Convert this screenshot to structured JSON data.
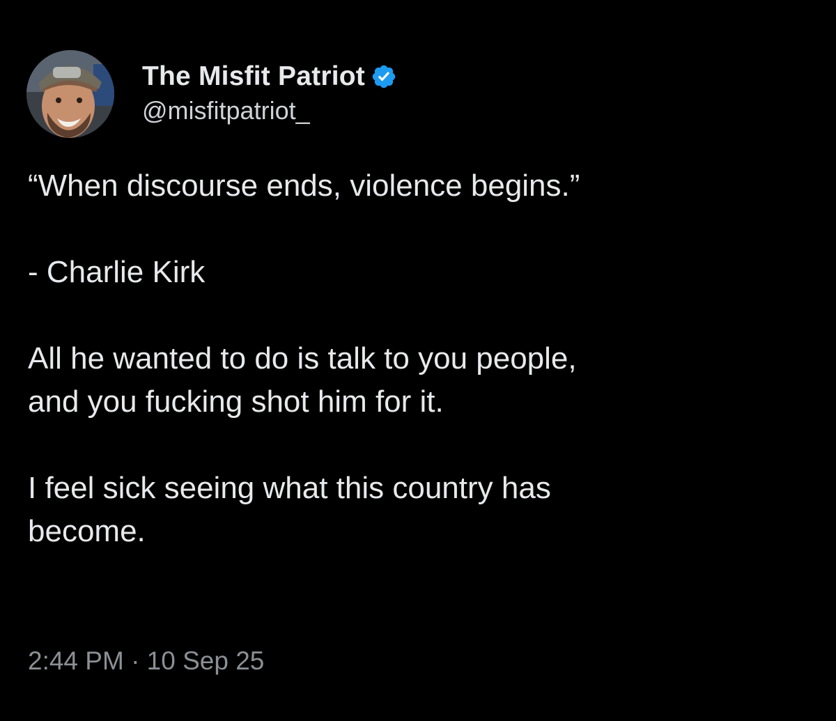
{
  "author": {
    "display_name": "The Misfit Patriot",
    "handle": "@misfitpatriot_",
    "verified": true,
    "verified_badge_icon": "verified-check-icon",
    "avatar_icon": "avatar-photo"
  },
  "tweet": {
    "paragraphs": [
      "“When discourse ends, violence begins.”",
      "- Charlie Kirk",
      "All he wanted to do is talk to you people,\nand you fucking shot him for it.",
      "I feel sick seeing what this country has\nbecome."
    ],
    "timestamp": "2:44 PM · 10 Sep 25"
  },
  "colors": {
    "background": "#000000",
    "text_primary": "#e7e9ea",
    "text_secondary": "#8b9095",
    "verified_blue": "#1d9bf0"
  }
}
